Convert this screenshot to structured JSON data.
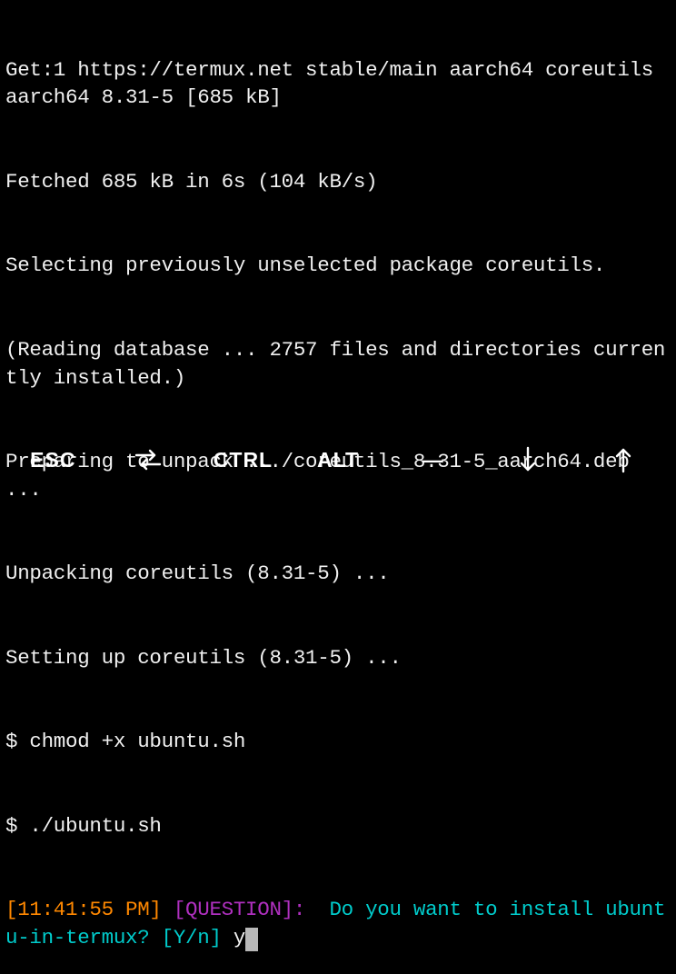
{
  "terminal": {
    "l1": "Get:1 https://termux.net stable/main aarch64 coreutils aarch64 8.31-5 [685 kB]",
    "l2": "Fetched 685 kB in 6s (104 kB/s)",
    "l3": "Selecting previously unselected package coreutils.",
    "l4": "(Reading database ... 2757 files and directories currently installed.)",
    "l5": "Preparing to unpack .../coreutils_8.31-5_aarch64.deb ...",
    "l6": "Unpacking coreutils (8.31-5) ...",
    "l7": "Setting up coreutils (8.31-5) ...",
    "l8": "$ chmod +x ubuntu.sh",
    "l9": "$ ./ubuntu.sh",
    "prompt": {
      "time": "[11:41:55 PM]",
      "label": "[QUESTION]:",
      "question": "Do you want to install ubuntu-in-termux? [Y/n] ",
      "answer": "y"
    }
  },
  "toolbar": {
    "esc": "ESC",
    "tab_icon": "tab-cycle-icon",
    "ctrl": "CTRL",
    "alt": "ALT",
    "minus": "—",
    "down_icon": "arrow-down-icon",
    "up_icon": "arrow-up-icon"
  }
}
